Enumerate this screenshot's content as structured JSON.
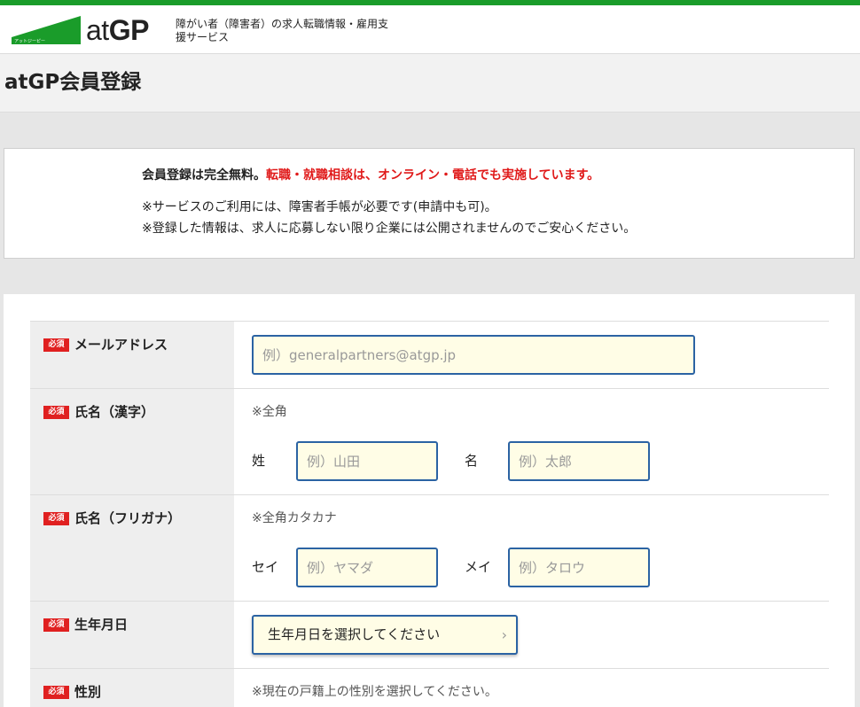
{
  "header": {
    "logo_small": "アットジーピー",
    "logo_at": "at",
    "logo_gp": "GP",
    "tagline": "障がい者（障害者）の求人転職情報・雇用支援サービス",
    "brand_color": "#1a9c2a"
  },
  "page": {
    "title": "atGP会員登録"
  },
  "notice": {
    "line1_black": "会員登録は完全無料。",
    "line1_red": "転職・就職相談は、オンライン・電話でも実施しています。",
    "line2": "※サービスのご利用には、障害者手帳が必要です(申請中も可)。",
    "line3": "※登録した情報は、求人に応募しない限り企業には公開されませんのでご安心ください。",
    "accent_color": "#e01a1a"
  },
  "form": {
    "required_badge": "必須",
    "email": {
      "label": "メールアドレス",
      "placeholder": "例）generalpartners@atgp.jp"
    },
    "name_kanji": {
      "label": "氏名（漢字）",
      "hint": "※全角",
      "last_label": "姓",
      "last_placeholder": "例）山田",
      "first_label": "名",
      "first_placeholder": "例）太郎"
    },
    "name_kana": {
      "label": "氏名（フリガナ）",
      "hint": "※全角カタカナ",
      "last_label": "セイ",
      "last_placeholder": "例）ヤマダ",
      "first_label": "メイ",
      "first_placeholder": "例）タロウ"
    },
    "birthdate": {
      "label": "生年月日",
      "select_label": "生年月日を選択してください"
    },
    "gender": {
      "label": "性別",
      "hint": "※現在の戸籍上の性別を選択してください。"
    }
  }
}
